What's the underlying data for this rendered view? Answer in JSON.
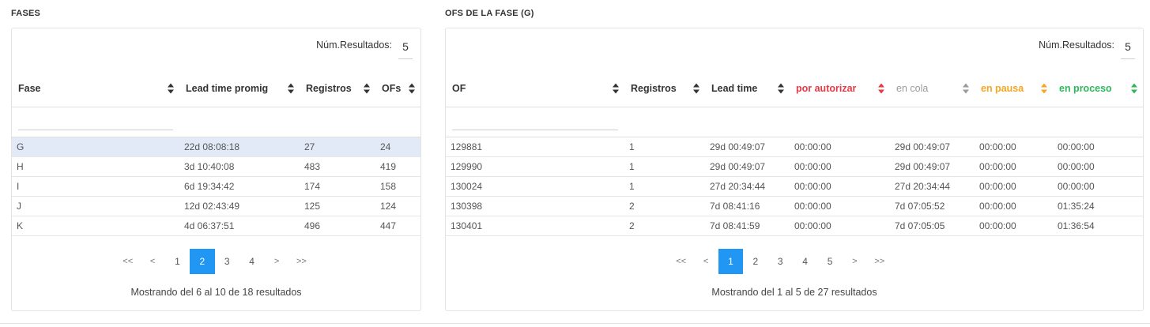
{
  "fases": {
    "title": "FASES",
    "num_results_label": "Núm.Resultados:",
    "num_results_value": "5",
    "headers": [
      "Fase",
      "Lead time promig",
      "Registros",
      "OFs"
    ],
    "rows": [
      [
        "G",
        "22d 08:08:18",
        "27",
        "24"
      ],
      [
        "H",
        "3d 10:40:08",
        "483",
        "419"
      ],
      [
        "I",
        "6d 19:34:42",
        "174",
        "158"
      ],
      [
        "J",
        "12d 02:43:49",
        "125",
        "124"
      ],
      [
        "K",
        "4d 06:37:51",
        "496",
        "447"
      ]
    ],
    "pagination": [
      "<<",
      "<",
      "1",
      "2",
      "3",
      "4",
      ">",
      ">>"
    ],
    "active_page": "2",
    "showing": "Mostrando del 6 al 10 de 18 resultados"
  },
  "ofs": {
    "title": "OFS DE LA FASE (G)",
    "num_results_label": "Núm.Resultados:",
    "num_results_value": "5",
    "headers": [
      "OF",
      "Registros",
      "Lead time",
      "por autorizar",
      "en cola",
      "en pausa",
      "en proceso"
    ],
    "rows": [
      [
        "129881",
        "1",
        "29d 00:49:07",
        "00:00:00",
        "29d 00:49:07",
        "00:00:00",
        "00:00:00"
      ],
      [
        "129990",
        "1",
        "29d 00:49:07",
        "00:00:00",
        "29d 00:49:07",
        "00:00:00",
        "00:00:00"
      ],
      [
        "130024",
        "1",
        "27d 20:34:44",
        "00:00:00",
        "27d 20:34:44",
        "00:00:00",
        "00:00:00"
      ],
      [
        "130398",
        "2",
        "7d 08:41:16",
        "00:00:00",
        "7d 07:05:52",
        "00:00:00",
        "01:35:24"
      ],
      [
        "130401",
        "2",
        "7d 08:41:59",
        "00:00:00",
        "7d 07:05:05",
        "00:00:00",
        "01:36:54"
      ]
    ],
    "pagination": [
      "<<",
      "<",
      "1",
      "2",
      "3",
      "4",
      "5",
      ">",
      ">>"
    ],
    "active_page": "1",
    "showing": "Mostrando del 1 al 5 de 27 resultados"
  },
  "colors": {
    "selected_row": "#e2eaf8",
    "active_page": "#2196f3",
    "of_link": "#9c27b0",
    "por_autorizar": "#e53946",
    "en_cola": "#9a9a9a",
    "en_pausa": "#f5a623",
    "en_proceso": "#2eb85c"
  }
}
